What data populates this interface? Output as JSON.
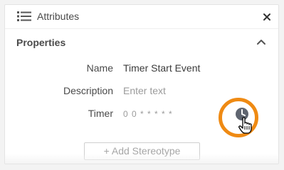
{
  "header": {
    "title": "Attributes",
    "icon": "list-icon",
    "close_icon": "close-icon"
  },
  "section": {
    "title": "Properties",
    "collapse_icon": "chevron-up-icon"
  },
  "fields": {
    "name": {
      "label": "Name",
      "value": "Timer Start Event"
    },
    "description": {
      "label": "Description",
      "placeholder": "Enter text"
    },
    "timer": {
      "label": "Timer",
      "value": "0 0 * * * * *",
      "icon": "clock-icon"
    }
  },
  "add_stereotype_label": "+ Add Stereotype",
  "colors": {
    "highlight": "#ef8a13",
    "clock_icon": "#5f6570",
    "text": "#4a4a4a",
    "placeholder": "#9b9b9b"
  }
}
